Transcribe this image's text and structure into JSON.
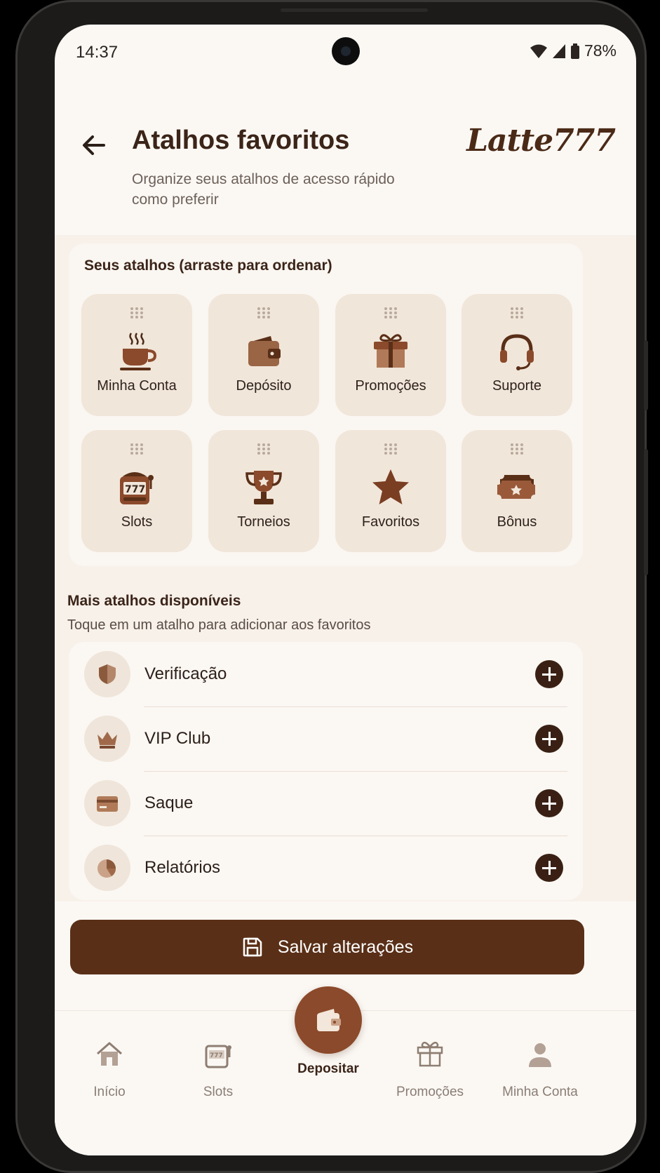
{
  "status_bar": {
    "time": "14:37",
    "battery": "78%"
  },
  "header": {
    "title": "Atalhos favoritos",
    "subtitle": "Organize seus atalhos de acesso rápido como preferir",
    "brand": "Latte777"
  },
  "favorites": {
    "title": "Seus atalhos (arraste para ordenar)",
    "items": [
      {
        "label": "Minha Conta",
        "icon": "coffee-cup-icon"
      },
      {
        "label": "Depósito",
        "icon": "wallet-icon"
      },
      {
        "label": "Promoções",
        "icon": "gift-icon"
      },
      {
        "label": "Suporte",
        "icon": "headset-icon"
      },
      {
        "label": "Slots",
        "icon": "slot-machine-icon"
      },
      {
        "label": "Torneios",
        "icon": "trophy-icon"
      },
      {
        "label": "Favoritos",
        "icon": "star-icon"
      },
      {
        "label": "Bônus",
        "icon": "ticket-icon"
      }
    ]
  },
  "available": {
    "title": "Mais atalhos disponíveis",
    "subtitle": "Toque em um atalho para adicionar aos favoritos",
    "items": [
      {
        "label": "Verificação",
        "icon": "shield-icon"
      },
      {
        "label": "VIP Club",
        "icon": "crown-icon"
      },
      {
        "label": "Saque",
        "icon": "card-icon"
      },
      {
        "label": "Relatórios",
        "icon": "pie-chart-icon"
      }
    ]
  },
  "save_button": {
    "label": "Salvar alterações",
    "icon": "save-icon"
  },
  "bottom_nav": {
    "items": [
      {
        "label": "Início",
        "icon": "home-icon"
      },
      {
        "label": "Slots",
        "icon": "slot-machine-icon"
      },
      {
        "label": "Depositar",
        "icon": "wallet-icon",
        "active": true
      },
      {
        "label": "Promoções",
        "icon": "gift-icon"
      },
      {
        "label": "Minha Conta",
        "icon": "user-icon"
      }
    ]
  },
  "colors": {
    "accent": "#5a2f17",
    "tile_bg": "#f1e6da",
    "icon_brown": "#8b5a3c",
    "background": "#fbf8f4"
  }
}
